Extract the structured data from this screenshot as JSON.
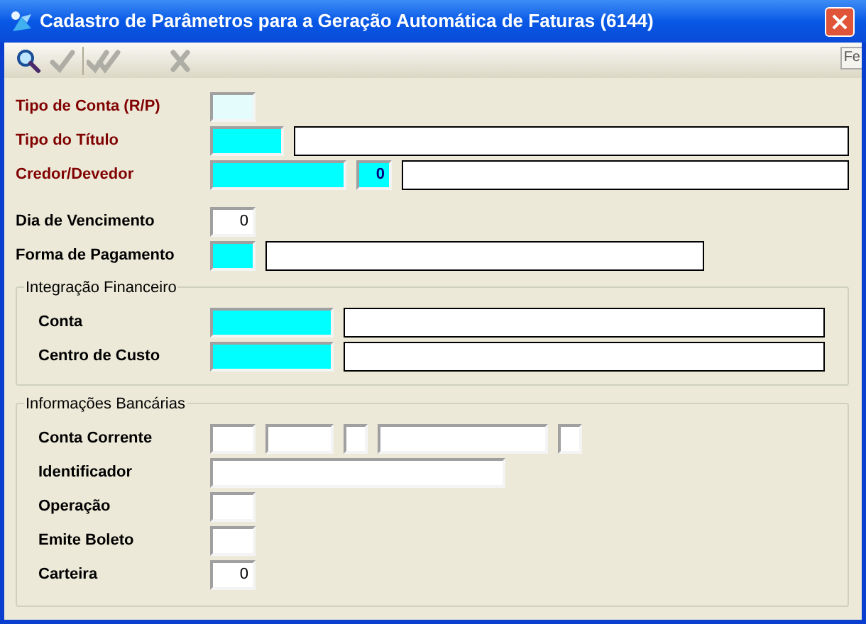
{
  "window": {
    "title": "Cadastro de Parâmetros para a Geração Automática de Faturas (6144)"
  },
  "toolbar": {
    "buttons": [
      {
        "kind": "search",
        "disabled": false
      },
      {
        "kind": "confirm",
        "disabled": true
      },
      {
        "kind": "confirm_all",
        "disabled": true
      },
      {
        "kind": "cancel",
        "disabled": true
      }
    ],
    "edge_label": "Fe"
  },
  "field_groups": [
    {
      "fields": [
        {
          "label": "Tipo de Conta (R/P)",
          "required": true,
          "inputs": [
            {
              "kind": "short",
              "color": "#e4fcfc"
            }
          ]
        },
        {
          "label": "Tipo do Título",
          "required": true,
          "inputs": [
            {
              "kind": "code",
              "color": "#00ffff"
            },
            {
              "kind": "desc",
              "color": "#ffffff"
            }
          ]
        },
        {
          "label": "Credor/Devedor",
          "required": true,
          "inputs": [
            {
              "kind": "long",
              "color": "#00ffff"
            },
            {
              "kind": "tiny_num",
              "color": "#00ffff",
              "value": "0",
              "emphasis": true
            },
            {
              "kind": "desc",
              "color": "#ffffff"
            }
          ]
        }
      ]
    },
    {
      "fields": [
        {
          "label": "Dia de Vencimento",
          "required": false,
          "inputs": [
            {
              "kind": "short",
              "color": "#ffffff",
              "value": "0",
              "emphasis": false
            }
          ]
        },
        {
          "label": "Forma de Pagamento",
          "required": false,
          "inputs": [
            {
              "kind": "short",
              "color": "#00ffff"
            },
            {
              "kind": "desc_medium",
              "color": "#ffffff"
            }
          ]
        }
      ]
    }
  ],
  "panels": [
    {
      "title": "Integração Financeiro",
      "fields": [
        {
          "label": "Conta",
          "required": false,
          "inputs": [
            {
              "kind": "wide",
              "color": "#00ffff"
            },
            {
              "kind": "desc",
              "color": "#ffffff"
            }
          ]
        },
        {
          "label": "Centro de Custo",
          "required": false,
          "inputs": [
            {
              "kind": "wide",
              "color": "#00ffff"
            },
            {
              "kind": "desc",
              "color": "#ffffff"
            }
          ]
        }
      ]
    },
    {
      "title": "Informações Bancárias",
      "fields": [
        {
          "label": "Conta Corrente",
          "required": false,
          "inputs": [
            {
              "kind": "short",
              "color": "#ffffff"
            },
            {
              "kind": "medium",
              "color": "#ffffff"
            },
            {
              "kind": "tiny",
              "color": "#ffffff"
            },
            {
              "kind": "name",
              "color": "#ffffff"
            },
            {
              "kind": "tiny",
              "color": "#ffffff"
            }
          ]
        },
        {
          "label": "Identificador",
          "required": false,
          "inputs": [
            {
              "kind": "id",
              "color": "#ffffff"
            }
          ]
        },
        {
          "label": "Operação",
          "required": false,
          "inputs": [
            {
              "kind": "short",
              "color": "#ffffff"
            }
          ]
        },
        {
          "label": "Emite Boleto",
          "required": false,
          "inputs": [
            {
              "kind": "short",
              "color": "#ffffff"
            }
          ]
        },
        {
          "label": "Carteira",
          "required": false,
          "inputs": [
            {
              "kind": "short",
              "color": "#ffffff",
              "value": "0",
              "emphasis": false
            }
          ]
        }
      ]
    }
  ]
}
